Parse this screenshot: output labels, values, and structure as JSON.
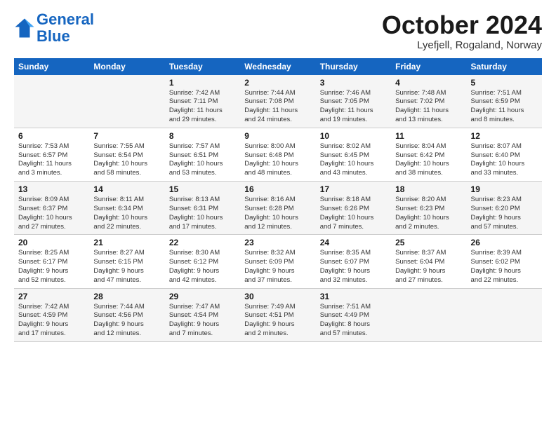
{
  "logo": {
    "line1": "General",
    "line2": "Blue"
  },
  "header": {
    "month": "October 2024",
    "location": "Lyefjell, Rogaland, Norway"
  },
  "days_of_week": [
    "Sunday",
    "Monday",
    "Tuesday",
    "Wednesday",
    "Thursday",
    "Friday",
    "Saturday"
  ],
  "weeks": [
    [
      {
        "day": "",
        "info": ""
      },
      {
        "day": "",
        "info": ""
      },
      {
        "day": "1",
        "info": "Sunrise: 7:42 AM\nSunset: 7:11 PM\nDaylight: 11 hours\nand 29 minutes."
      },
      {
        "day": "2",
        "info": "Sunrise: 7:44 AM\nSunset: 7:08 PM\nDaylight: 11 hours\nand 24 minutes."
      },
      {
        "day": "3",
        "info": "Sunrise: 7:46 AM\nSunset: 7:05 PM\nDaylight: 11 hours\nand 19 minutes."
      },
      {
        "day": "4",
        "info": "Sunrise: 7:48 AM\nSunset: 7:02 PM\nDaylight: 11 hours\nand 13 minutes."
      },
      {
        "day": "5",
        "info": "Sunrise: 7:51 AM\nSunset: 6:59 PM\nDaylight: 11 hours\nand 8 minutes."
      }
    ],
    [
      {
        "day": "6",
        "info": "Sunrise: 7:53 AM\nSunset: 6:57 PM\nDaylight: 11 hours\nand 3 minutes."
      },
      {
        "day": "7",
        "info": "Sunrise: 7:55 AM\nSunset: 6:54 PM\nDaylight: 10 hours\nand 58 minutes."
      },
      {
        "day": "8",
        "info": "Sunrise: 7:57 AM\nSunset: 6:51 PM\nDaylight: 10 hours\nand 53 minutes."
      },
      {
        "day": "9",
        "info": "Sunrise: 8:00 AM\nSunset: 6:48 PM\nDaylight: 10 hours\nand 48 minutes."
      },
      {
        "day": "10",
        "info": "Sunrise: 8:02 AM\nSunset: 6:45 PM\nDaylight: 10 hours\nand 43 minutes."
      },
      {
        "day": "11",
        "info": "Sunrise: 8:04 AM\nSunset: 6:42 PM\nDaylight: 10 hours\nand 38 minutes."
      },
      {
        "day": "12",
        "info": "Sunrise: 8:07 AM\nSunset: 6:40 PM\nDaylight: 10 hours\nand 33 minutes."
      }
    ],
    [
      {
        "day": "13",
        "info": "Sunrise: 8:09 AM\nSunset: 6:37 PM\nDaylight: 10 hours\nand 27 minutes."
      },
      {
        "day": "14",
        "info": "Sunrise: 8:11 AM\nSunset: 6:34 PM\nDaylight: 10 hours\nand 22 minutes."
      },
      {
        "day": "15",
        "info": "Sunrise: 8:13 AM\nSunset: 6:31 PM\nDaylight: 10 hours\nand 17 minutes."
      },
      {
        "day": "16",
        "info": "Sunrise: 8:16 AM\nSunset: 6:28 PM\nDaylight: 10 hours\nand 12 minutes."
      },
      {
        "day": "17",
        "info": "Sunrise: 8:18 AM\nSunset: 6:26 PM\nDaylight: 10 hours\nand 7 minutes."
      },
      {
        "day": "18",
        "info": "Sunrise: 8:20 AM\nSunset: 6:23 PM\nDaylight: 10 hours\nand 2 minutes."
      },
      {
        "day": "19",
        "info": "Sunrise: 8:23 AM\nSunset: 6:20 PM\nDaylight: 9 hours\nand 57 minutes."
      }
    ],
    [
      {
        "day": "20",
        "info": "Sunrise: 8:25 AM\nSunset: 6:17 PM\nDaylight: 9 hours\nand 52 minutes."
      },
      {
        "day": "21",
        "info": "Sunrise: 8:27 AM\nSunset: 6:15 PM\nDaylight: 9 hours\nand 47 minutes."
      },
      {
        "day": "22",
        "info": "Sunrise: 8:30 AM\nSunset: 6:12 PM\nDaylight: 9 hours\nand 42 minutes."
      },
      {
        "day": "23",
        "info": "Sunrise: 8:32 AM\nSunset: 6:09 PM\nDaylight: 9 hours\nand 37 minutes."
      },
      {
        "day": "24",
        "info": "Sunrise: 8:35 AM\nSunset: 6:07 PM\nDaylight: 9 hours\nand 32 minutes."
      },
      {
        "day": "25",
        "info": "Sunrise: 8:37 AM\nSunset: 6:04 PM\nDaylight: 9 hours\nand 27 minutes."
      },
      {
        "day": "26",
        "info": "Sunrise: 8:39 AM\nSunset: 6:02 PM\nDaylight: 9 hours\nand 22 minutes."
      }
    ],
    [
      {
        "day": "27",
        "info": "Sunrise: 7:42 AM\nSunset: 4:59 PM\nDaylight: 9 hours\nand 17 minutes."
      },
      {
        "day": "28",
        "info": "Sunrise: 7:44 AM\nSunset: 4:56 PM\nDaylight: 9 hours\nand 12 minutes."
      },
      {
        "day": "29",
        "info": "Sunrise: 7:47 AM\nSunset: 4:54 PM\nDaylight: 9 hours\nand 7 minutes."
      },
      {
        "day": "30",
        "info": "Sunrise: 7:49 AM\nSunset: 4:51 PM\nDaylight: 9 hours\nand 2 minutes."
      },
      {
        "day": "31",
        "info": "Sunrise: 7:51 AM\nSunset: 4:49 PM\nDaylight: 8 hours\nand 57 minutes."
      },
      {
        "day": "",
        "info": ""
      },
      {
        "day": "",
        "info": ""
      }
    ]
  ]
}
